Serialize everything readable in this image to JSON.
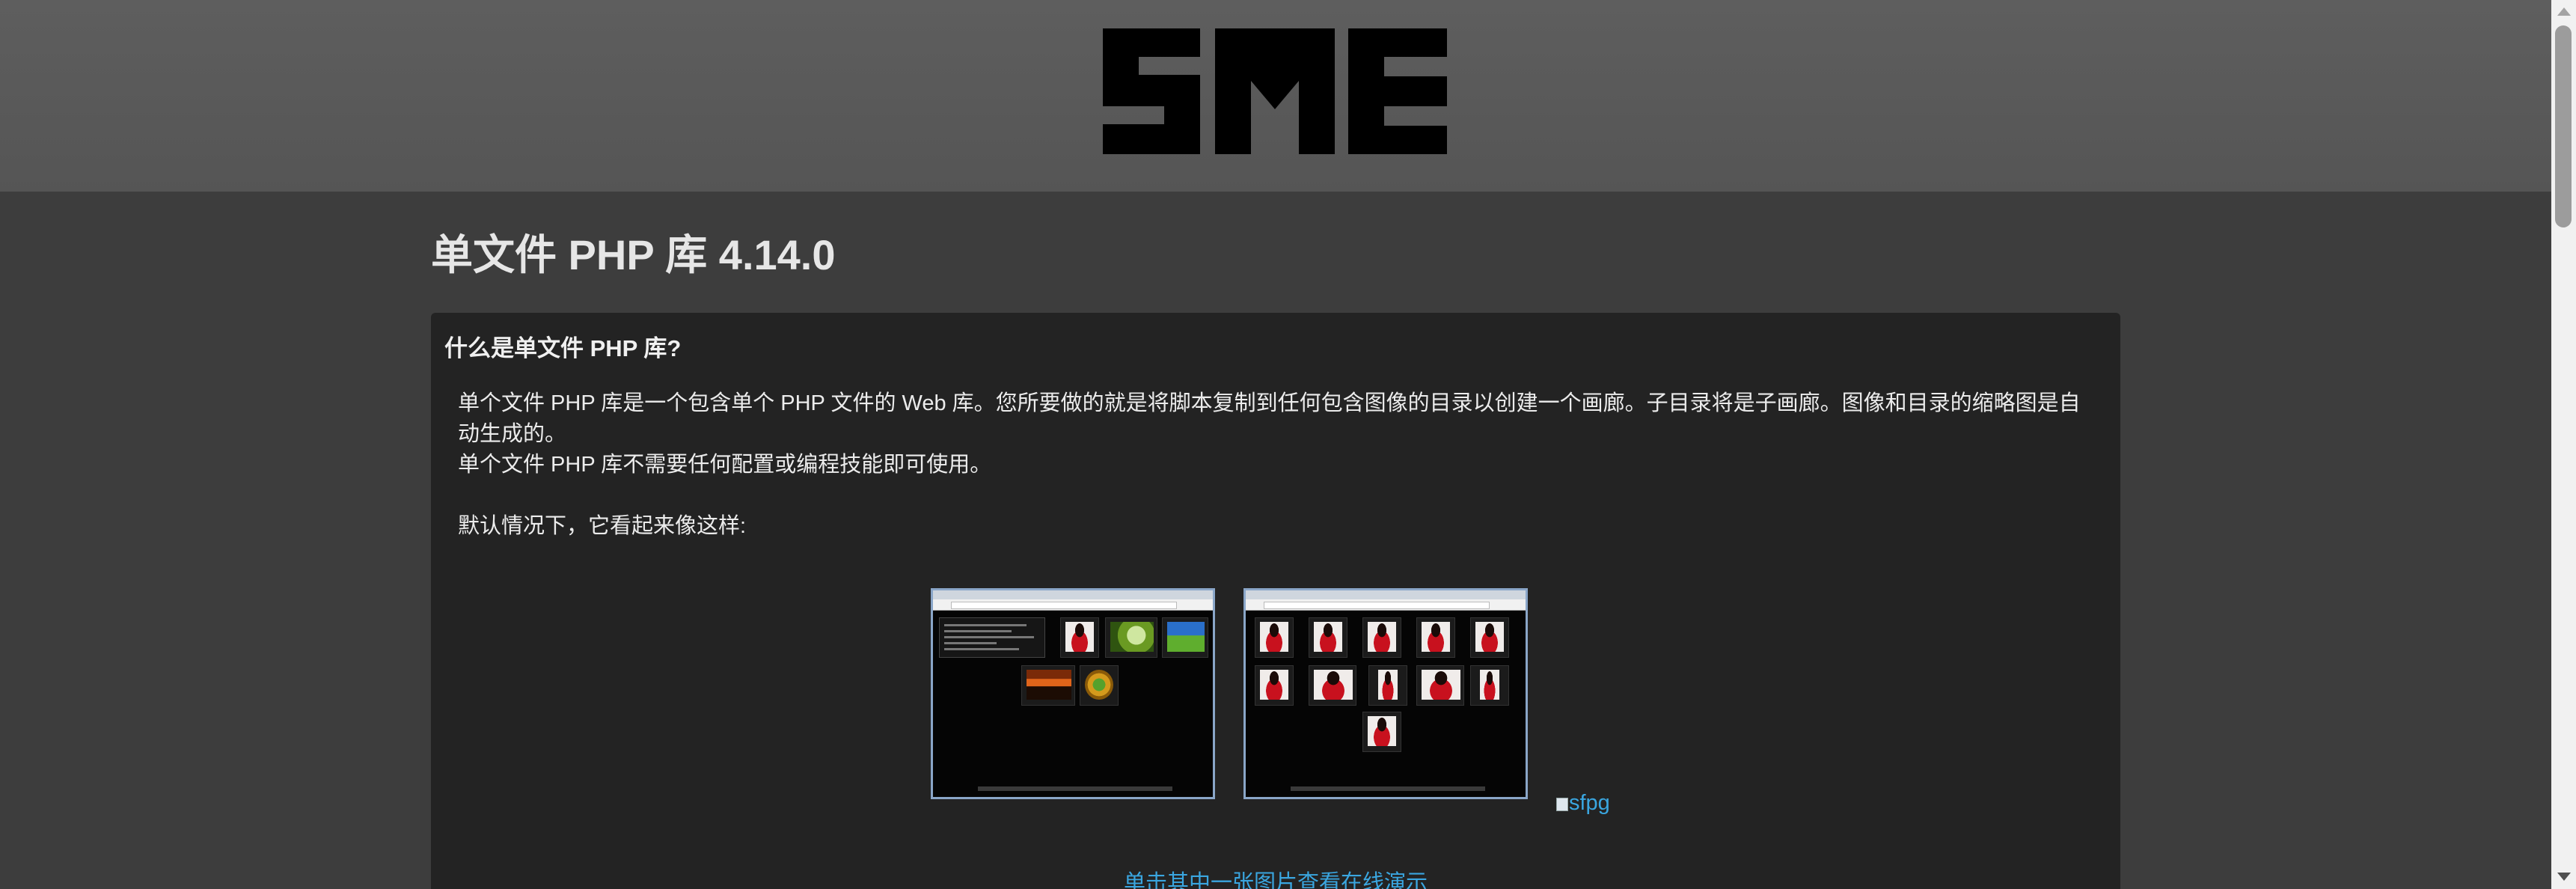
{
  "header": {
    "logo_name": "SME logo"
  },
  "page": {
    "title": "单文件 PHP 库 4.14.0"
  },
  "panel": {
    "heading": "什么是单文件 PHP 库?",
    "paragraph_line1": "单个文件 PHP 库是一个包含单个 PHP 文件的 Web 库。您所要做的就是将脚本复制到任何包含图像的目录以创建一个画廊。子目录将是子画廊。图像和目录的缩略图是自动生成的。",
    "paragraph_line2": "单个文件 PHP 库不需要任何配置或编程技能即可使用。",
    "paragraph_line3": "默认情况下，它看起来像这样:",
    "broken_image_alt": "sfpg",
    "demo_link": "单击其中一张图片查看在线演示"
  },
  "colors": {
    "link": "#3aa6e0",
    "panel_bg": "#232323",
    "page_bg": "#3d3d3d",
    "header_bg": "#5a5a5a"
  }
}
